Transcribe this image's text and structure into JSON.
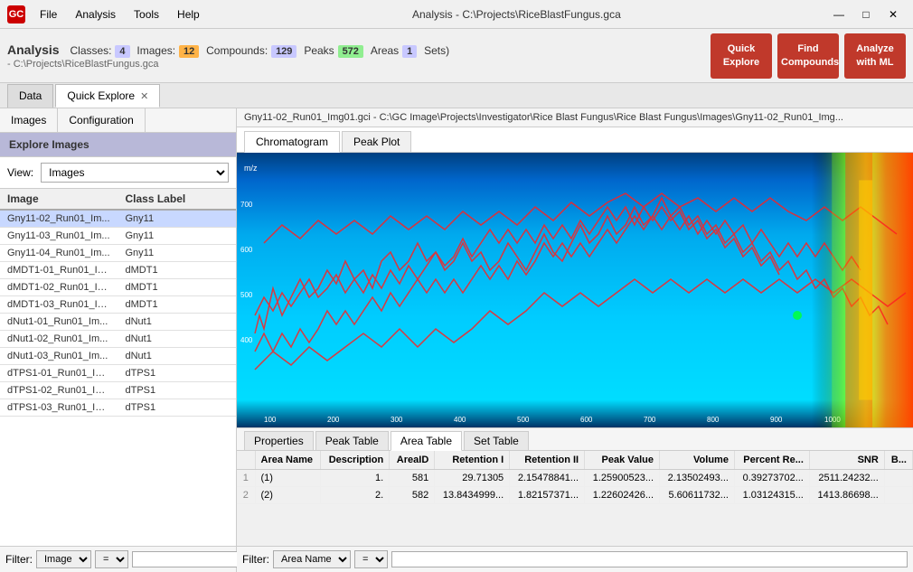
{
  "titleBar": {
    "logo": "GC",
    "menus": [
      "File",
      "Analysis",
      "Tools",
      "Help"
    ],
    "title": "Analysis - C:\\Projects\\RiceBlastFungus.gca",
    "controls": [
      "—",
      "□",
      "✕"
    ]
  },
  "analysisHeader": {
    "title": "Analysis",
    "badges": {
      "classes_label": "Classes:",
      "classes_count": "4",
      "images_label": "Images:",
      "images_count": "12",
      "compounds_label": "Compounds:",
      "compounds_count": "129",
      "peaks_label": "Peaks",
      "peaks_count": "572",
      "areas_label": "Areas",
      "areas_count": "1",
      "sets_label": "Sets)"
    },
    "path": "- C:\\Projects\\RiceBlastFungus.gca",
    "buttons": [
      {
        "id": "quick-explore",
        "label": "Quick\nExplore"
      },
      {
        "id": "find-compounds",
        "label": "Find\nCompounds"
      },
      {
        "id": "analyze-ml",
        "label": "Analyze\nwith ML"
      }
    ]
  },
  "tabs": [
    {
      "id": "data",
      "label": "Data",
      "closable": false
    },
    {
      "id": "quick-explore",
      "label": "Quick Explore",
      "closable": true
    }
  ],
  "leftPanel": {
    "tabs": [
      "Images",
      "Configuration"
    ],
    "exploreHeader": "Explore Images",
    "viewLabel": "View:",
    "viewOptions": [
      "Images"
    ],
    "tableHeaders": [
      "Image",
      "Class Label"
    ],
    "rows": [
      {
        "image": "Gny11-02_Run01_Im...",
        "class": "Gny11",
        "selected": true
      },
      {
        "image": "Gny11-03_Run01_Im...",
        "class": "Gny11"
      },
      {
        "image": "Gny11-04_Run01_Im...",
        "class": "Gny11"
      },
      {
        "image": "dMDT1-01_Run01_Im...",
        "class": "dMDT1"
      },
      {
        "image": "dMDT1-02_Run01_Im...",
        "class": "dMDT1"
      },
      {
        "image": "dMDT1-03_Run01_Im...",
        "class": "dMDT1"
      },
      {
        "image": "dNut1-01_Run01_Im...",
        "class": "dNut1"
      },
      {
        "image": "dNut1-02_Run01_Im...",
        "class": "dNut1"
      },
      {
        "image": "dNut1-03_Run01_Im...",
        "class": "dNut1"
      },
      {
        "image": "dTPS1-01_Run01_Im...",
        "class": "dTPS1"
      },
      {
        "image": "dTPS1-02_Run01_Im...",
        "class": "dTPS1"
      },
      {
        "image": "dTPS1-03_Run01_Im...",
        "class": "dTPS1"
      }
    ],
    "filterLabel": "Filter:",
    "filterOptions": [
      "Image"
    ],
    "filterEqOptions": [
      "="
    ],
    "filterValue": ""
  },
  "rightPanel": {
    "filePath": "Gny11-02_Run01_Img01.gci - C:\\GC Image\\Projects\\Investigator\\Rice Blast Fungus\\Rice Blast Fungus\\Images\\Gny11-02_Run01_Img...",
    "viewTabs": [
      "Chromatogram",
      "Peak Plot"
    ],
    "bottomTabs": [
      "Properties",
      "Peak Table",
      "Area Table",
      "Set Table"
    ],
    "tableHeaders": [
      "",
      "Area Name",
      "Description",
      "AreaID",
      "Retention I",
      "Retention II",
      "Peak Value",
      "Volume",
      "Percent Re...",
      "SNR",
      "B..."
    ],
    "tableRows": [
      {
        "idx": "1",
        "name": "(1)",
        "desc": "1.",
        "id": "581",
        "ret1": "29.71305",
        "ret2": "2.15478841...",
        "peak": "1.25900523...",
        "vol": "2.13502493...",
        "pct": "0.39273702...",
        "snr": "2511.24232...",
        "b": ""
      },
      {
        "idx": "2",
        "name": "(2)",
        "desc": "2.",
        "id": "582",
        "ret1": "13.8434999...",
        "ret2": "1.82157371...",
        "peak": "1.22602426...",
        "vol": "5.60611732...",
        "pct": "1.03124315...",
        "snr": "1413.86698...",
        "b": ""
      }
    ],
    "bottomFilter": {
      "filterOptions": [
        "Area Name"
      ],
      "filterEqOptions": [
        "="
      ],
      "filterValue": ""
    }
  }
}
